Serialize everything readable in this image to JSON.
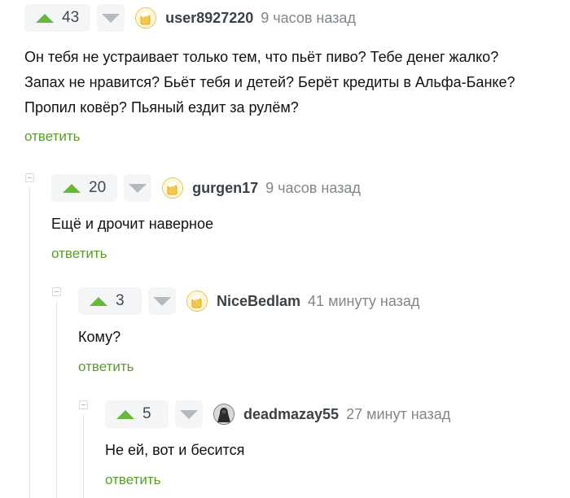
{
  "comments": [
    {
      "rating": "43",
      "username": "user8927220",
      "time": "9 часов назад",
      "avatar": "avatar-default-icon",
      "lines": [
        "Он тебя не устраивает только тем, что пьёт пиво? Тебе денег жалко?",
        "Запах не нравится? Бьёт тебя и детей? Берёт кредиты в Альфа-Банке?",
        "Пропил ковёр? Пьяный ездит за рулём?"
      ],
      "reply": "ответить"
    },
    {
      "rating": "20",
      "username": "gurgen17",
      "time": "9 часов назад",
      "avatar": "avatar-default-icon",
      "lines": [
        "Ещё и дрочит наверное"
      ],
      "reply": "ответить"
    },
    {
      "rating": "3",
      "username": "NiceBedlam",
      "time": "41 минуту назад",
      "avatar": "avatar-default-icon",
      "lines": [
        "Кому?"
      ],
      "reply": "ответить"
    },
    {
      "rating": "5",
      "username": "deadmazay55",
      "time": "27 минут назад",
      "avatar": "avatar-dark-figure-icon",
      "lines": [
        "Не ей, вот и бесится"
      ],
      "reply": "ответить"
    }
  ],
  "colors": {
    "upvote": "#6ab73f",
    "reply_link": "#5a9b2e",
    "muted": "#80878c"
  }
}
